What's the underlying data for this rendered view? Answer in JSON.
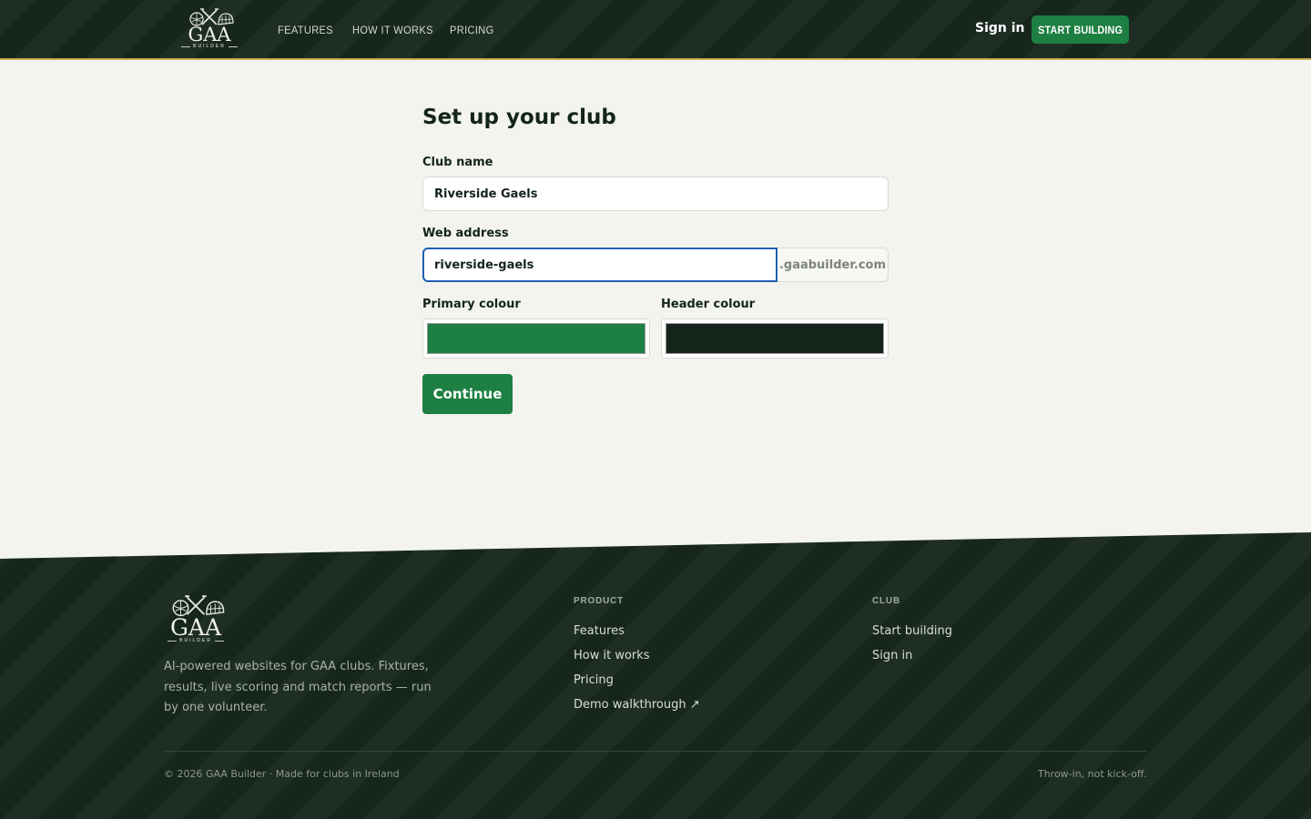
{
  "header": {
    "logo": {
      "title": "GAA",
      "subtitle": "BUILDER"
    },
    "nav": [
      "FEATURES",
      "HOW IT WORKS",
      "PRICING"
    ],
    "sign_in": "Sign in",
    "cta": "START BUILDING"
  },
  "form": {
    "title": "Set up your club",
    "club_name": {
      "label": "Club name",
      "value": "Riverside Gaels"
    },
    "web_address": {
      "label": "Web address",
      "value": "riverside-gaels",
      "suffix": ".gaabuilder.com"
    },
    "primary_colour": {
      "label": "Primary colour",
      "value": "#1e7f42"
    },
    "header_colour": {
      "label": "Header colour",
      "value": "#14241b"
    },
    "continue": "Continue"
  },
  "footer": {
    "logo": {
      "title": "GAA",
      "subtitle": "BUILDER"
    },
    "description": "AI-powered websites for GAA clubs. Fixtures, results, live scoring and match reports — run by one volunteer.",
    "product": {
      "heading": "PRODUCT",
      "links": [
        "Features",
        "How it works",
        "Pricing",
        "Demo walkthrough ↗"
      ]
    },
    "club": {
      "heading": "CLUB",
      "links": [
        "Start building",
        "Sign in"
      ]
    },
    "copyright": "© 2026 GAA Builder · Made for clubs in Ireland",
    "tagline": "Throw-in, not kick-off."
  },
  "colors": {
    "brand_green": "#1e7f42",
    "dark_green": "#16261d",
    "gold_accent": "#c9b25a",
    "focus_blue": "#1f5fb4"
  },
  "icons": [
    "hurley-sticks-icon",
    "gaelic-ball-icon",
    "hurling-helmet-icon",
    "external-link-icon"
  ]
}
